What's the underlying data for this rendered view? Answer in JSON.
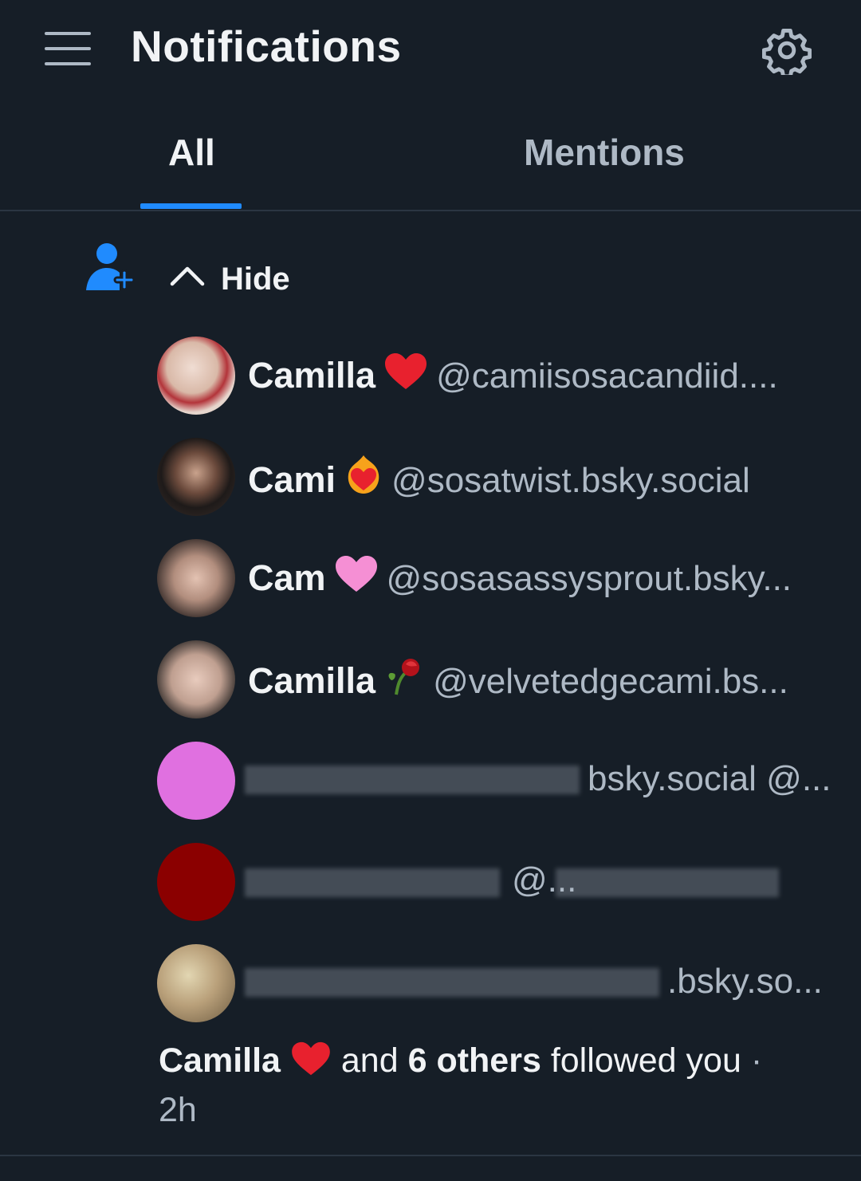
{
  "header": {
    "title": "Notifications",
    "menu_icon": "hamburger-menu-icon",
    "settings_icon": "gear-icon"
  },
  "tabs": [
    {
      "label": "All",
      "active": true
    },
    {
      "label": "Mentions",
      "active": false
    }
  ],
  "colors": {
    "background": "#161e27",
    "accent": "#208bfe",
    "text_primary": "#f1f3f5",
    "text_secondary": "#aeb9c5",
    "heart_red": "#e8212e",
    "heart_pink": "#f58fd4"
  },
  "notification": {
    "type_icon": "person-add-icon",
    "toggle_label": "Hide",
    "toggle_icon": "chevron-up-icon",
    "followers": [
      {
        "name": "Camilla",
        "emoji": "red-heart",
        "handle": "@camiisosacandiid...."
      },
      {
        "name": "Cami",
        "emoji": "heart-on-fire",
        "handle": "@sosatwist.bsky.social"
      },
      {
        "name": "Cam",
        "emoji": "pink-heart",
        "handle": "@sosasassysprout.bsky..."
      },
      {
        "name": "Camilla",
        "emoji": "wilted-rose",
        "handle": "@velvetedgecami.bs..."
      },
      {
        "name": "",
        "emoji": "",
        "handle": "bsky.social @..."
      },
      {
        "name": "",
        "emoji": "",
        "handle": "@..."
      },
      {
        "name": "",
        "emoji": "",
        "handle": ".bsky.so..."
      }
    ],
    "summary": {
      "lead_name": "Camilla",
      "and_text": "and",
      "others_text": "6 others",
      "action_text": "followed you",
      "separator": "·",
      "time": "2h"
    }
  }
}
